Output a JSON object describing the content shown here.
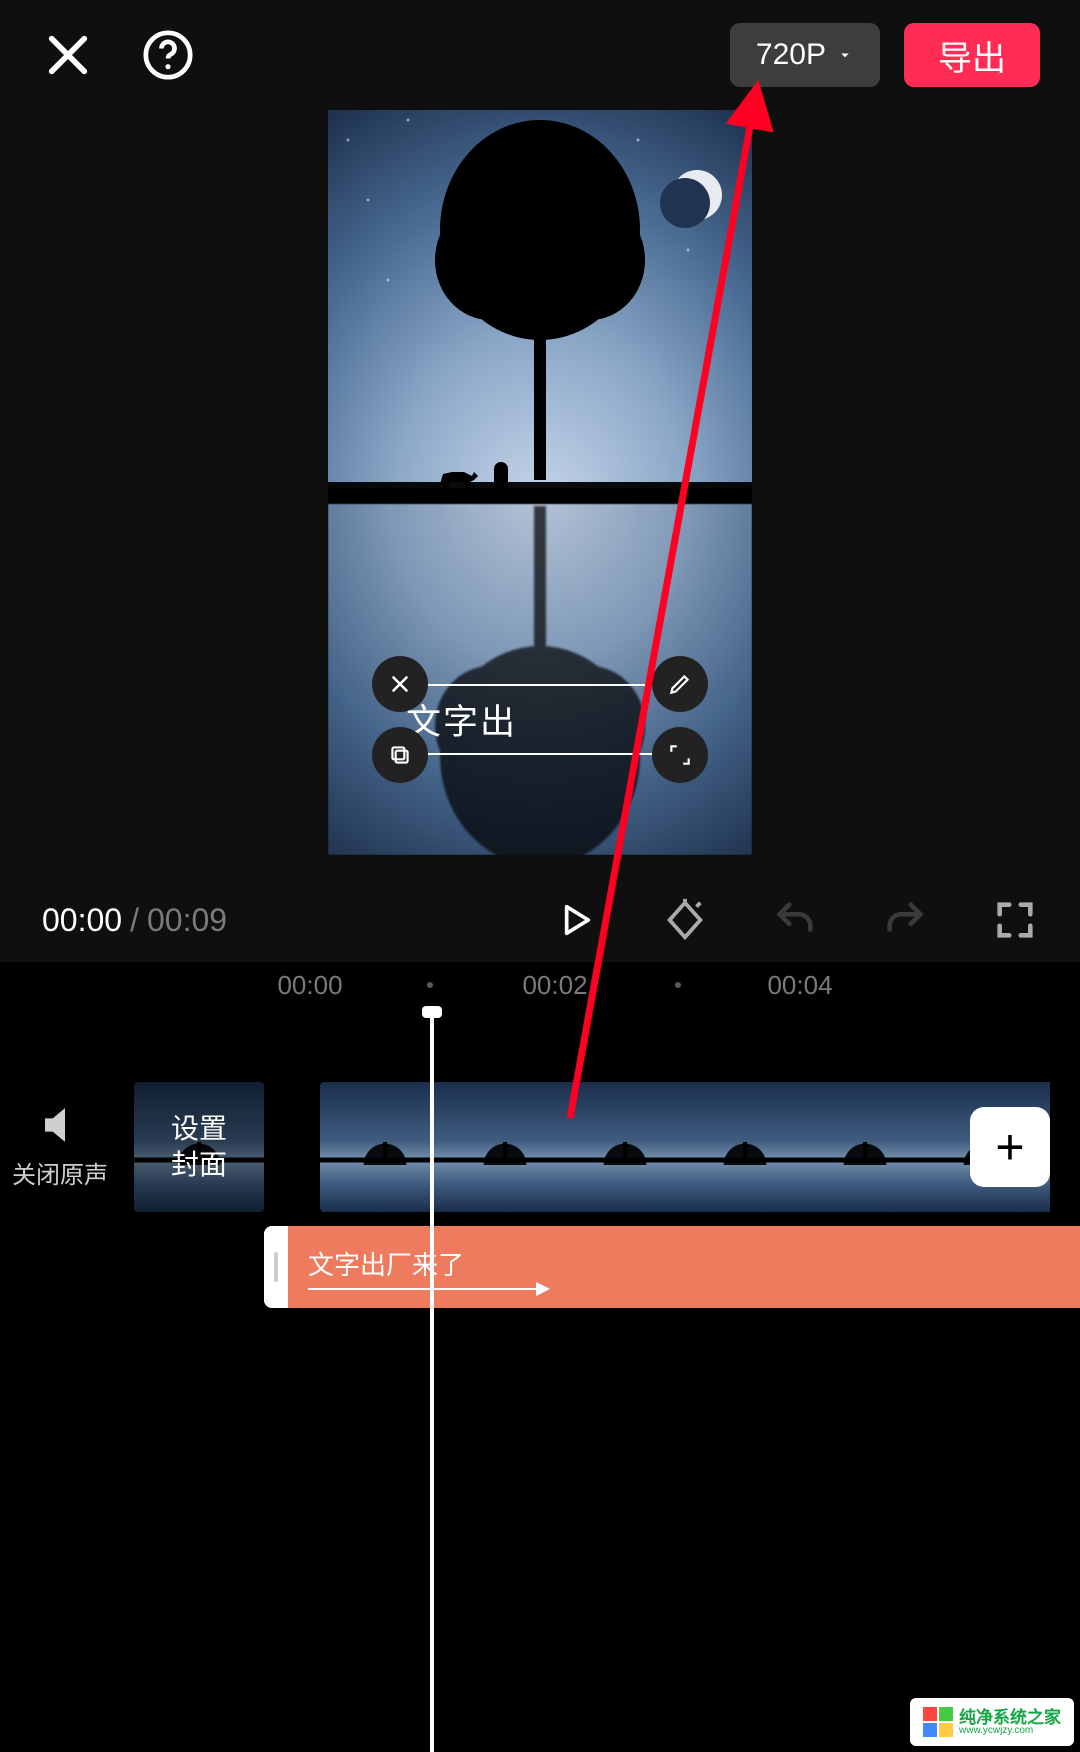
{
  "topbar": {
    "resolution_label": "720P",
    "export_label": "导出"
  },
  "preview": {
    "text_overlay": "文字出"
  },
  "playback": {
    "current_time": "00:00",
    "total_time": "00:09"
  },
  "timeline": {
    "ruler_labels": [
      "00:00",
      "00:02",
      "00:04"
    ],
    "mute_label": "关闭原声",
    "cover_label": "设置\n封面",
    "text_track_label": "文字出厂来了",
    "add_label": "+"
  },
  "watermark": {
    "title": "纯净系统之家",
    "url": "www.ycwjzy.com"
  }
}
